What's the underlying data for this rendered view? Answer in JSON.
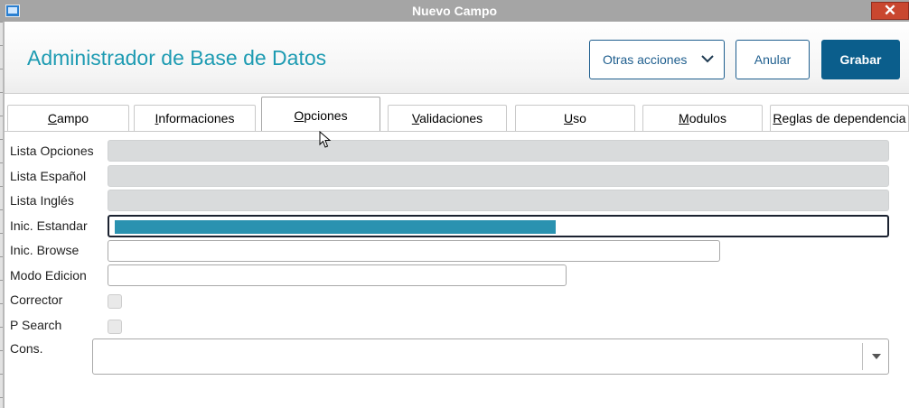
{
  "window": {
    "title": "Nuevo Campo",
    "close_glyph": "✕"
  },
  "header": {
    "title": "Administrador de Base de Datos",
    "other_actions_label": "Otras acciones",
    "cancel_label": "Anular",
    "save_label": "Grabar"
  },
  "tabs": [
    {
      "label": "Campo",
      "key": "C",
      "rest": "ampo"
    },
    {
      "label": "Informaciones",
      "key": "I",
      "rest": "nformaciones"
    },
    {
      "label": "Opciones",
      "key": "O",
      "rest": "pciones",
      "active": true
    },
    {
      "label": "Validaciones",
      "key": "V",
      "rest": "alidaciones"
    },
    {
      "label": "Uso",
      "key": "U",
      "rest": "so"
    },
    {
      "label": "Modulos",
      "key": "M",
      "rest": "odulos"
    },
    {
      "label": "Reglas de dependencia",
      "key": "R",
      "rest": "eglas de dependencia"
    }
  ],
  "form": {
    "lista_opciones": {
      "label": "Lista Opciones",
      "value": ""
    },
    "lista_espanol": {
      "label": "Lista Español",
      "value": ""
    },
    "lista_ingles": {
      "label": "Lista Inglés",
      "value": ""
    },
    "inic_estandar": {
      "label": "Inic. Estandar",
      "value": ""
    },
    "inic_browse": {
      "label": "Inic. Browse",
      "value": ""
    },
    "modo_edicion": {
      "label": "Modo Edicion",
      "value": ""
    },
    "corrector": {
      "label": "Corrector",
      "checked": false
    },
    "p_search": {
      "label": "P Search",
      "checked": false
    },
    "cons_estandar": {
      "label": "Cons.",
      "value": ""
    }
  },
  "colors": {
    "title": "#1d9bb2",
    "primary_button": "#0b5e8c",
    "selection": "#2a92b0",
    "close_button": "#c9472f"
  }
}
